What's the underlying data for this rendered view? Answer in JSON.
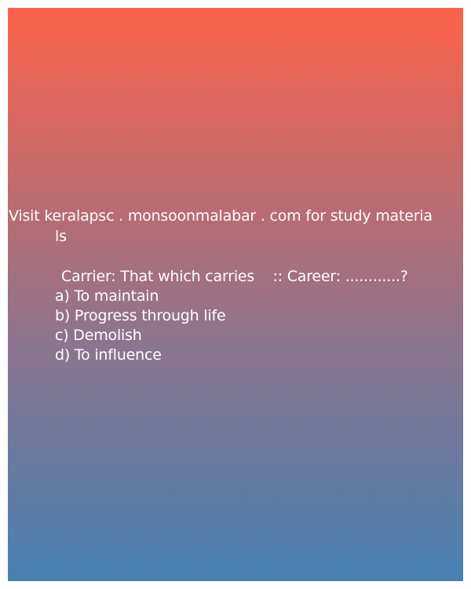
{
  "header": {
    "site_line1": "Visit keralapsc . monsoonmalabar . com for study materia",
    "site_line2": "ls"
  },
  "question": {
    "text": "Carrier: That which carries    :: Career: ............?"
  },
  "options": [
    {
      "label": "a) To maintain"
    },
    {
      "label": "b) Progress through life"
    },
    {
      "label": "c) Demolish"
    },
    {
      "label": "d) To influence"
    }
  ],
  "colors": {
    "gradient_top": "#fc624a",
    "gradient_bottom": "#4681b2",
    "text": "#ffffff"
  }
}
